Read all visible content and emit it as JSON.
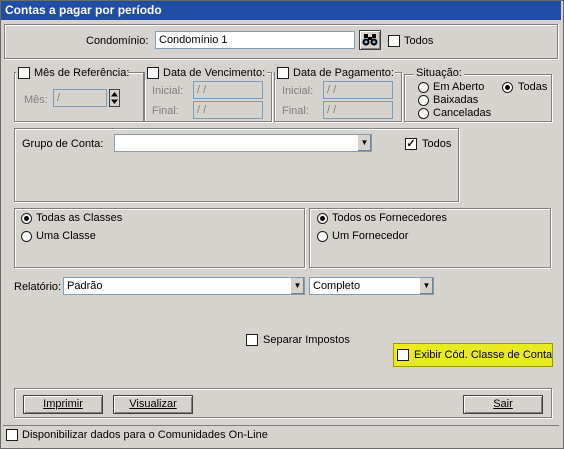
{
  "window": {
    "title": "Contas a pagar por período"
  },
  "condominio": {
    "label": "Condomínio:",
    "value": "Condomínio 1",
    "todos_label": "Todos"
  },
  "mes_ref": {
    "label": "Mês de Referência:",
    "mes_label": "Mês:",
    "mes_value": " / "
  },
  "data_venc": {
    "label": "Data de Vencimento:",
    "inicial_label": "Inicial:",
    "final_label": "Final:",
    "inicial_value": " / /",
    "final_value": " / /"
  },
  "data_pag": {
    "label": "Data de Pagamento:",
    "inicial_label": "Inicial:",
    "final_label": "Final:",
    "inicial_value": " / /",
    "final_value": " / /"
  },
  "situacao": {
    "label": "Situação:",
    "options": [
      "Em Aberto",
      "Todas",
      "Baixadas",
      "Canceladas"
    ],
    "selected": "Todas"
  },
  "grupo": {
    "label": "Grupo de Conta:",
    "value": "",
    "todos_label": "Todos",
    "todos_checked": true
  },
  "classes": {
    "options": [
      "Todas as Classes",
      "Uma Classe"
    ],
    "selected": "Todas as Classes"
  },
  "fornecedores": {
    "options": [
      "Todos os Fornecedores",
      "Um Fornecedor"
    ],
    "selected": "Todos os Fornecedores"
  },
  "relatorio": {
    "label": "Relatório:",
    "value": "Padrão",
    "tipo_value": "Completo"
  },
  "separar_impostos": {
    "label": "Separar Impostos",
    "checked": false
  },
  "exibir_cod": {
    "label": "Exibir Cód. Classe de Conta",
    "checked": false
  },
  "buttons": {
    "imprimir": "Imprimir",
    "visualizar": "Visualizar",
    "sair": "Sair"
  },
  "footer": {
    "label": "Disponibilizar dados para o Comunidades On-Line"
  }
}
